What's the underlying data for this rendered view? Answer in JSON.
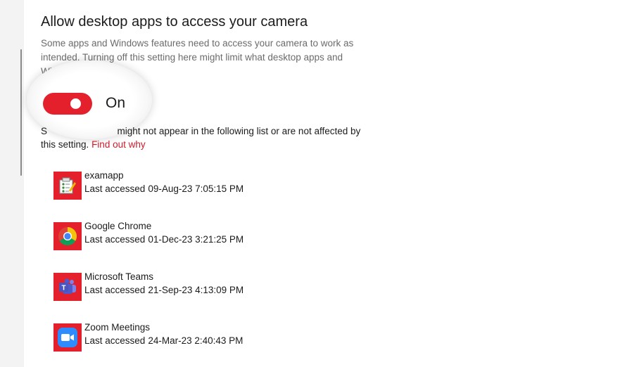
{
  "section": {
    "title": "Allow desktop apps to access your camera",
    "description": "Some apps and Windows features need to access your camera to work as intended. Turning off this setting here might limit what desktop apps and Windows can do."
  },
  "toggle": {
    "state": "On",
    "on": true,
    "color": "#e4202d"
  },
  "note": {
    "visible_prefix": "S",
    "text": "might not appear in the following list or are not affected by this setting.",
    "link": "Find out why"
  },
  "last_accessed_prefix": "Last accessed",
  "apps": [
    {
      "name": "examapp",
      "last_accessed": "09-Aug-23 7:05:15 PM",
      "icon": "examapp-icon"
    },
    {
      "name": "Google Chrome",
      "last_accessed": "01-Dec-23 3:21:25 PM",
      "icon": "chrome-icon"
    },
    {
      "name": "Microsoft Teams",
      "last_accessed": "21-Sep-23 4:13:09 PM",
      "icon": "teams-icon"
    },
    {
      "name": "Zoom Meetings",
      "last_accessed": "24-Mar-23 2:40:43 PM",
      "icon": "zoom-icon"
    }
  ],
  "colors": {
    "accent": "#e4202d",
    "link": "#d01a2a",
    "icon_tile": "#e4202d"
  }
}
